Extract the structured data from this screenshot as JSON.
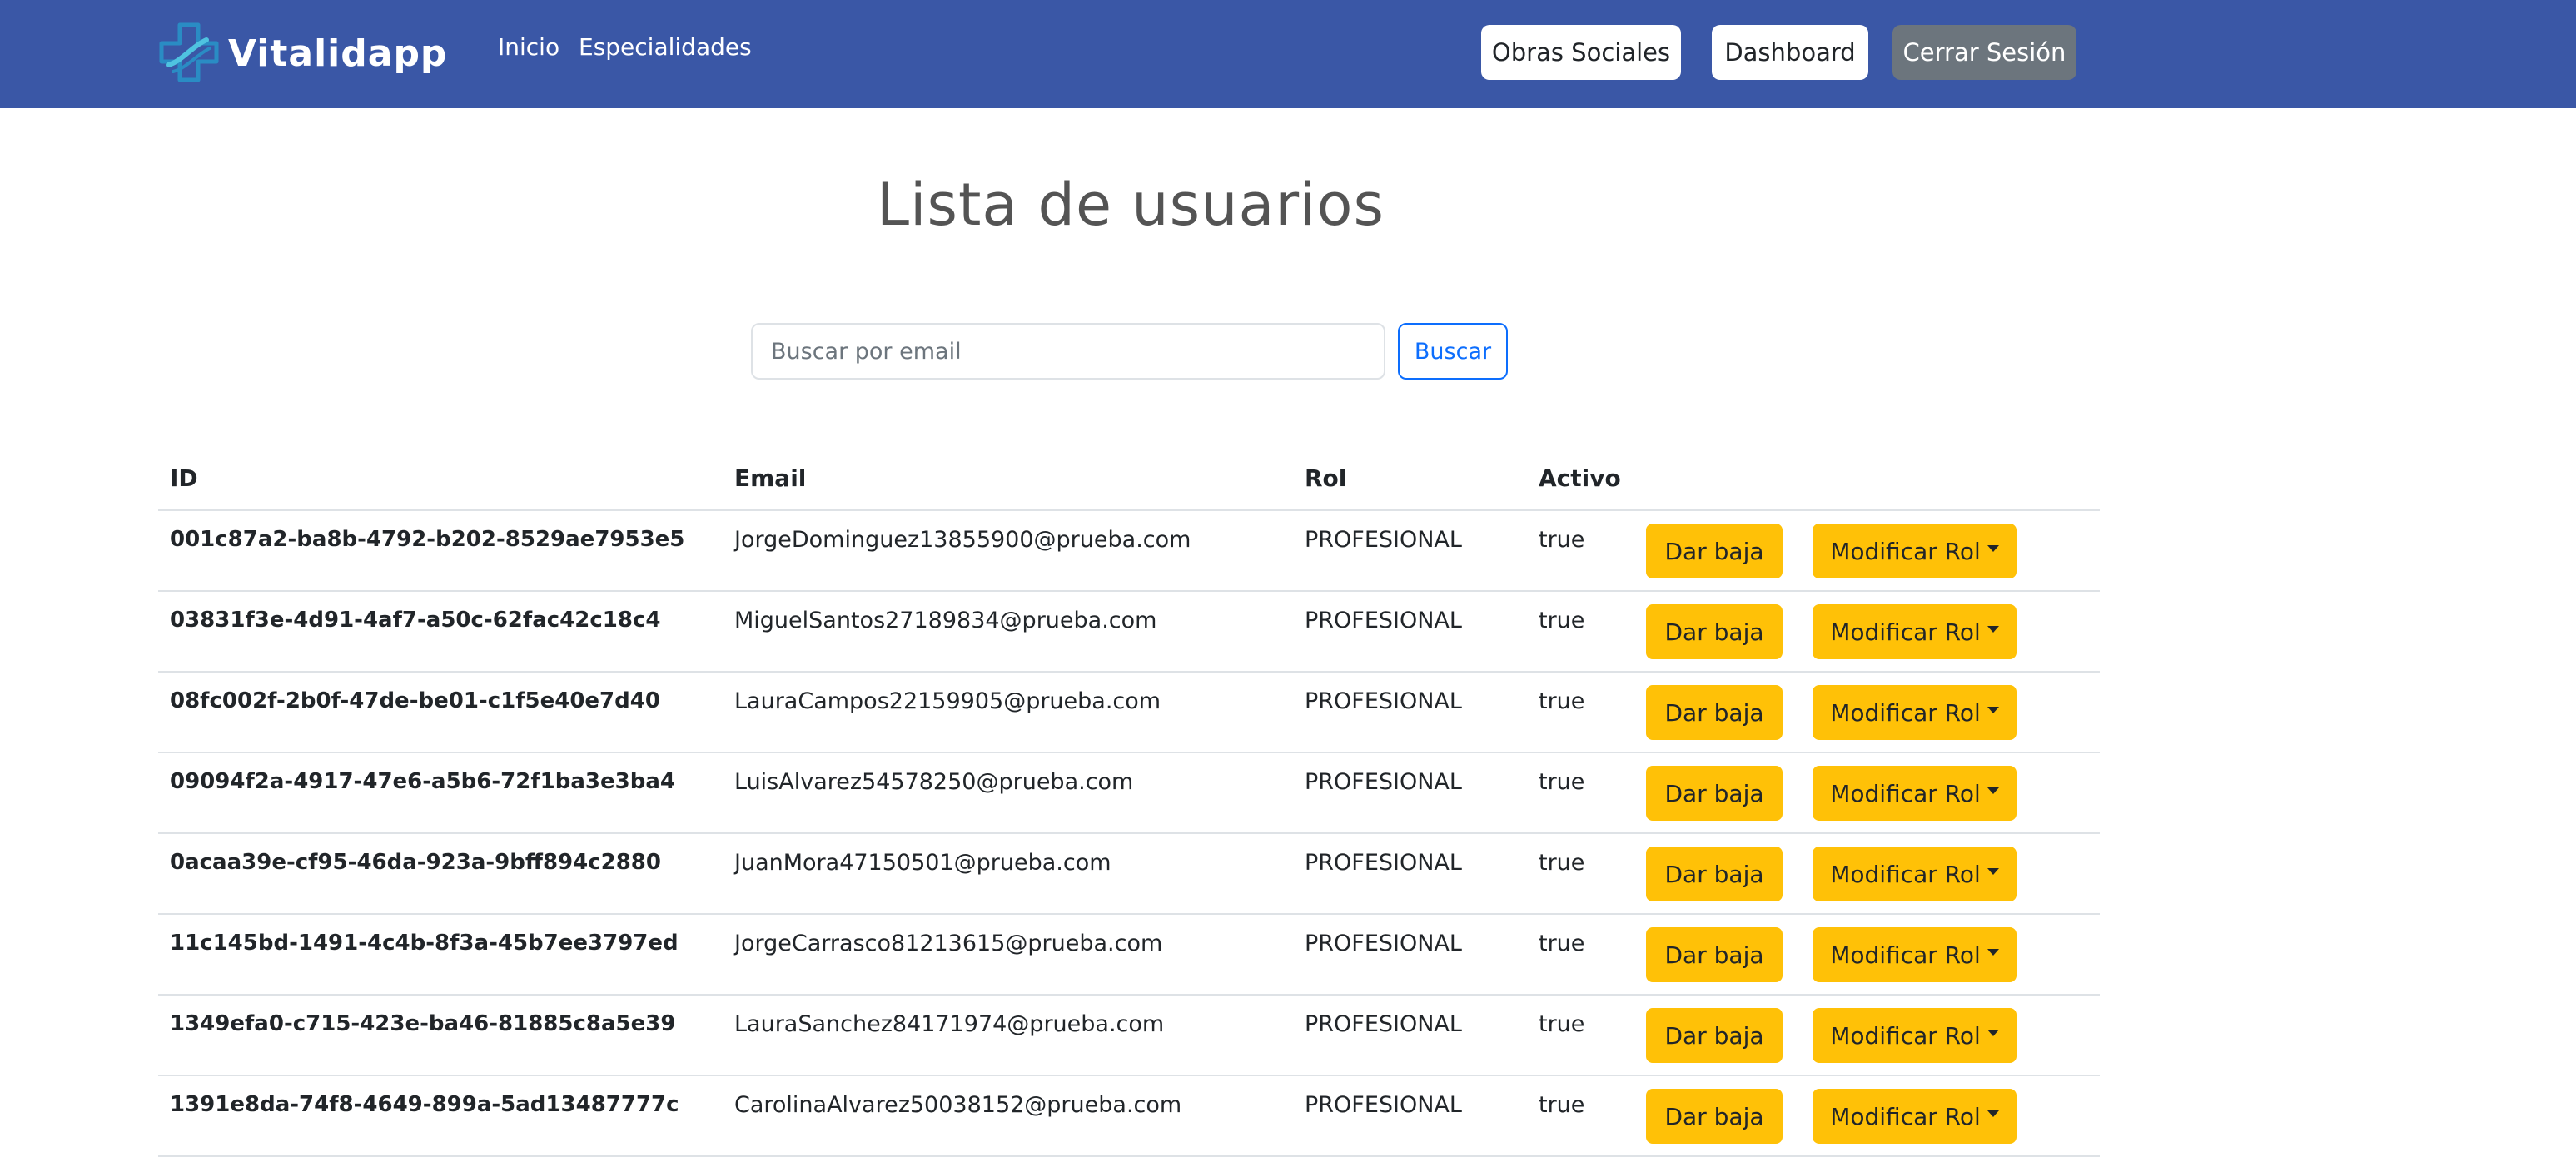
{
  "navbar": {
    "brand": "Vitalidapp",
    "links": [
      "Inicio",
      "Especialidades"
    ],
    "buttons": {
      "obras_sociales": "Obras Sociales",
      "dashboard": "Dashboard",
      "cerrar_sesion": "Cerrar Sesión"
    },
    "colors": {
      "background": "#3a57a6",
      "logo_primary": "#2a8cc4",
      "logo_secondary": "#4fc3e0"
    }
  },
  "page_title": "Lista de usuarios",
  "search": {
    "placeholder": "Buscar por email",
    "value": "",
    "button_label": "Buscar"
  },
  "table": {
    "headers": {
      "id": "ID",
      "email": "Email",
      "rol": "Rol",
      "activo": "Activo"
    },
    "action_labels": {
      "dar_baja": "Dar baja",
      "modificar_rol": "Modificar Rol"
    },
    "rows": [
      {
        "id": "001c87a2-ba8b-4792-b202-8529ae7953e5",
        "email": "JorgeDominguez13855900@prueba.com",
        "rol": "PROFESIONAL",
        "activo": "true"
      },
      {
        "id": "03831f3e-4d91-4af7-a50c-62fac42c18c4",
        "email": "MiguelSantos27189834@prueba.com",
        "rol": "PROFESIONAL",
        "activo": "true"
      },
      {
        "id": "08fc002f-2b0f-47de-be01-c1f5e40e7d40",
        "email": "LauraCampos22159905@prueba.com",
        "rol": "PROFESIONAL",
        "activo": "true"
      },
      {
        "id": "09094f2a-4917-47e6-a5b6-72f1ba3e3ba4",
        "email": "LuisAlvarez54578250@prueba.com",
        "rol": "PROFESIONAL",
        "activo": "true"
      },
      {
        "id": "0acaa39e-cf95-46da-923a-9bff894c2880",
        "email": "JuanMora47150501@prueba.com",
        "rol": "PROFESIONAL",
        "activo": "true"
      },
      {
        "id": "11c145bd-1491-4c4b-8f3a-45b7ee3797ed",
        "email": "JorgeCarrasco81213615@prueba.com",
        "rol": "PROFESIONAL",
        "activo": "true"
      },
      {
        "id": "1349efa0-c715-423e-ba46-81885c8a5e39",
        "email": "LauraSanchez84171974@prueba.com",
        "rol": "PROFESIONAL",
        "activo": "true"
      },
      {
        "id": "1391e8da-74f8-4649-899a-5ad13487777c",
        "email": "CarolinaAlvarez50038152@prueba.com",
        "rol": "PROFESIONAL",
        "activo": "true"
      }
    ]
  },
  "colors": {
    "warning_button": "#ffc107",
    "primary_outline": "#0d6efd",
    "secondary_button": "#6c757d"
  }
}
